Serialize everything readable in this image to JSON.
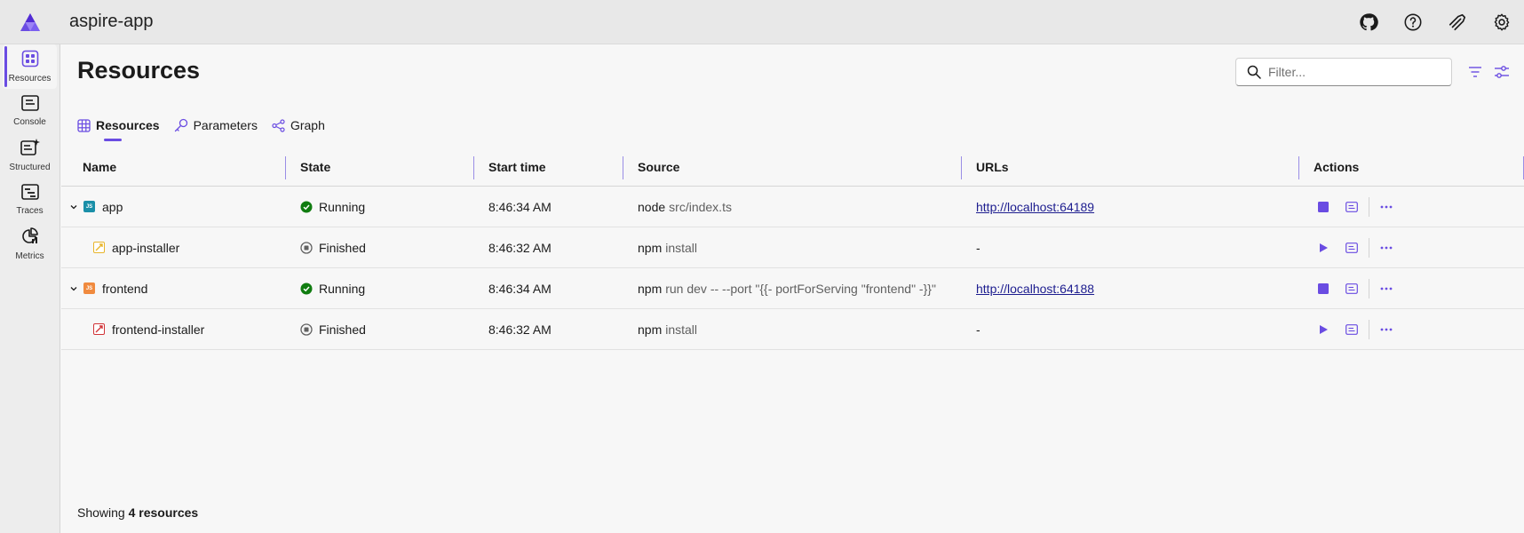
{
  "app": {
    "title": "aspire-app"
  },
  "header": {
    "icons": [
      "github-icon",
      "help-icon",
      "docs-icon",
      "settings-icon"
    ]
  },
  "sidebar": {
    "items": [
      {
        "label": "Resources",
        "icon": "resources-icon",
        "active": true
      },
      {
        "label": "Console",
        "icon": "console-icon",
        "active": false
      },
      {
        "label": "Structured",
        "icon": "structured-icon",
        "active": false
      },
      {
        "label": "Traces",
        "icon": "traces-icon",
        "active": false
      },
      {
        "label": "Metrics",
        "icon": "metrics-icon",
        "active": false
      }
    ]
  },
  "page": {
    "title": "Resources",
    "filter_placeholder": "Filter...",
    "tabs": [
      {
        "label": "Resources",
        "active": true
      },
      {
        "label": "Parameters",
        "active": false
      },
      {
        "label": "Graph",
        "active": false
      }
    ]
  },
  "table": {
    "headers": [
      "Name",
      "State",
      "Start time",
      "Source",
      "URLs",
      "Actions"
    ],
    "rows": [
      {
        "name": "app",
        "type": "js-teal",
        "expandable": true,
        "state": "Running",
        "start": "8:46:34 AM",
        "src_cmd": "node",
        "src_args": "src/index.ts",
        "url": "http://localhost:64189",
        "running": true
      },
      {
        "name": "app-installer",
        "type": "installer-yellow",
        "expandable": false,
        "state": "Finished",
        "start": "8:46:32 AM",
        "src_cmd": "npm",
        "src_args": "install",
        "url": "-",
        "running": false
      },
      {
        "name": "frontend",
        "type": "js-orange",
        "expandable": true,
        "state": "Running",
        "start": "8:46:34 AM",
        "src_cmd": "npm",
        "src_args": "run dev -- --port \"{{- portForServing \"frontend\" -}}\"",
        "url": "http://localhost:64188",
        "running": true
      },
      {
        "name": "frontend-installer",
        "type": "installer-red",
        "expandable": false,
        "state": "Finished",
        "start": "8:46:32 AM",
        "src_cmd": "npm",
        "src_args": "install",
        "url": "-",
        "running": false
      }
    ]
  },
  "footer": {
    "prefix": "Showing",
    "count": "4 resources"
  },
  "colors": {
    "accent": "#6a4ce2",
    "running": "#107c10",
    "link": "#1d1d8f"
  }
}
